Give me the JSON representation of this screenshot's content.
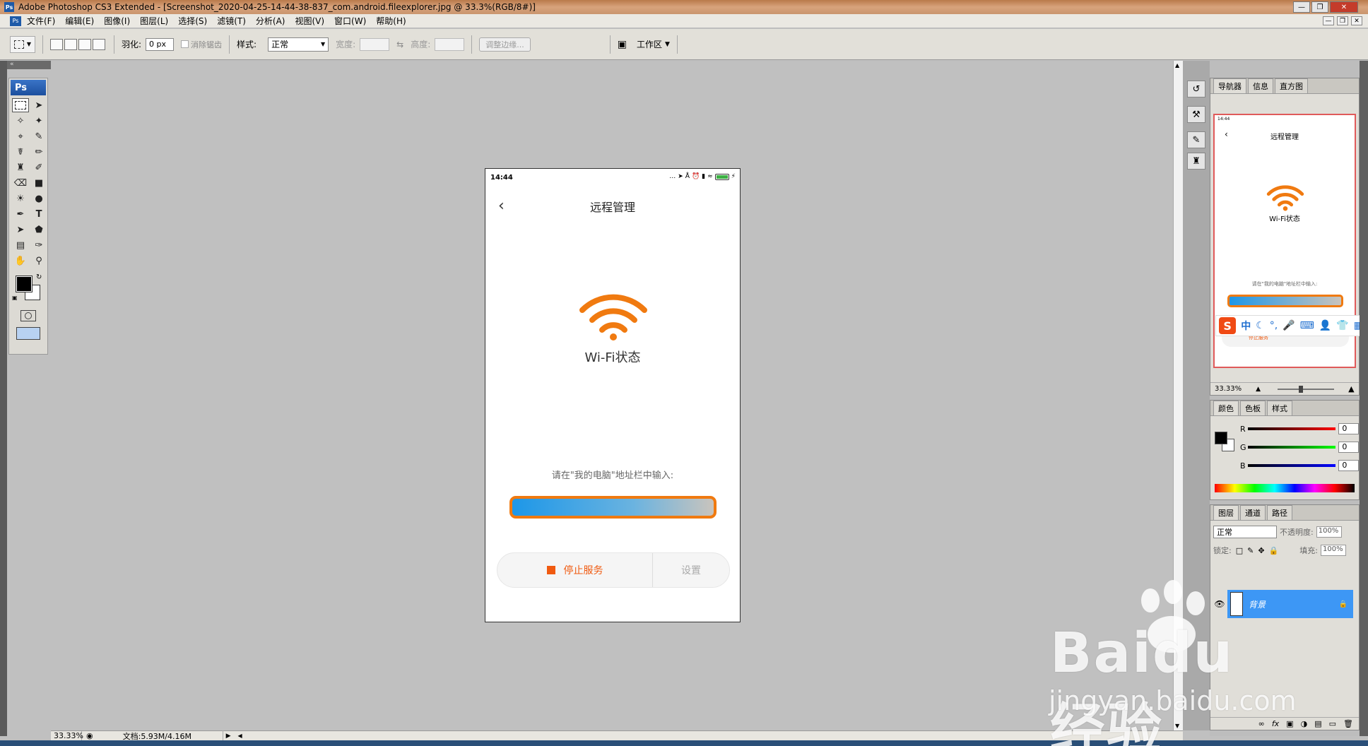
{
  "window": {
    "title": "Adobe Photoshop CS3 Extended - [Screenshot_2020-04-25-14-44-38-837_com.android.fileexplorer.jpg @ 33.3%(RGB/8#)]",
    "app_icon_text": "Ps"
  },
  "menu": {
    "items": [
      "文件(F)",
      "编辑(E)",
      "图像(I)",
      "图层(L)",
      "选择(S)",
      "滤镜(T)",
      "分析(A)",
      "视图(V)",
      "窗口(W)",
      "帮助(H)"
    ]
  },
  "options": {
    "feather_label": "羽化:",
    "feather_value": "0 px",
    "antialias_label": "消除锯齿",
    "style_label": "样式:",
    "style_value": "正常",
    "width_label": "宽度:",
    "height_label": "高度:",
    "refine_edge_label": "调整边缘...",
    "workspace_label": "工作区"
  },
  "toolbox": {
    "badge": "Ps"
  },
  "document": {
    "status_time": "14:44",
    "battery_level": "78",
    "page_title": "远程管理",
    "wifi_label": "Wi-Fi状态",
    "instruction": "请在\"我的电脑\"地址栏中输入:",
    "stop_label": "停止服务",
    "settings_label": "设置",
    "colors": {
      "accent": "#f07a10",
      "stop_text": "#f05a10"
    }
  },
  "panels": {
    "navigator": {
      "tabs": [
        "导航器",
        "信息",
        "直方图"
      ],
      "zoom": "33.33%",
      "preview_time": "14:44",
      "preview_title": "远程管理",
      "preview_wifi_label": "Wi-Fi状态",
      "preview_instruction": "请在\"我的电脑\"地址栏中输入:",
      "preview_stop": "停止服务"
    },
    "color": {
      "tabs": [
        "颜色",
        "色板",
        "样式"
      ],
      "r_label": "R",
      "g_label": "G",
      "b_label": "B",
      "r_value": "0",
      "g_value": "0",
      "b_value": "0"
    },
    "layers": {
      "tabs": [
        "图层",
        "通道",
        "路径"
      ],
      "blend_mode": "正常",
      "opacity_label": "不透明度:",
      "opacity_value": "100%",
      "lock_label": "锁定:",
      "fill_label": "填充:",
      "fill_value": "100%",
      "layer_name": "背景"
    }
  },
  "ime": {
    "logo": "S",
    "mode": "中"
  },
  "status": {
    "zoom": "33.33%",
    "doc_info": "文档:5.93M/4.16M"
  },
  "watermark": {
    "main": "Baidu经验",
    "sub": "jingyan.baidu.com"
  }
}
